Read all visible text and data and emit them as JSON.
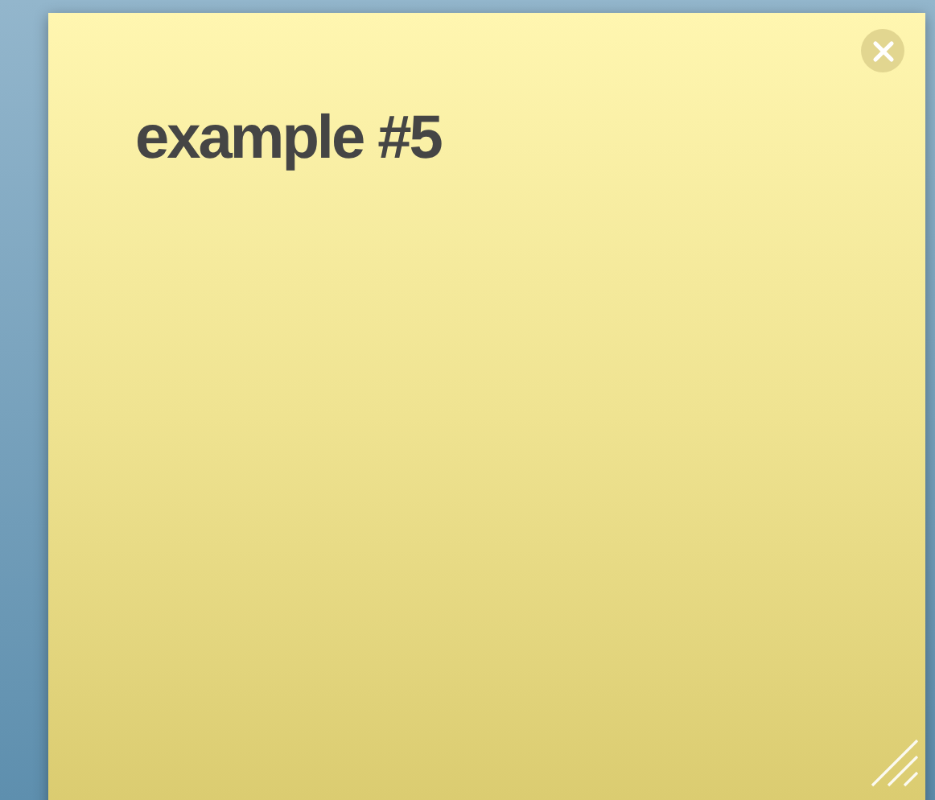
{
  "note": {
    "title": "example #5"
  }
}
